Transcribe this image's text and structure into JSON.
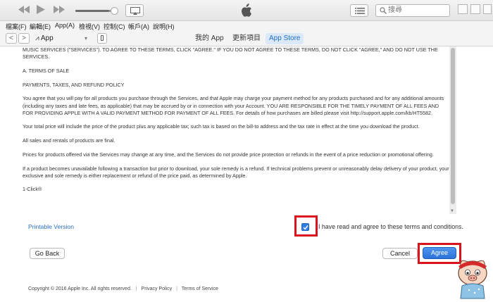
{
  "topbar": {
    "search_placeholder": "搜尋"
  },
  "menubar": {
    "items": [
      "檔案(F)",
      "編輯(E)",
      "App(A)",
      "檢視(V)",
      "控制(C)",
      "帳戶(A)",
      "說明(H)"
    ]
  },
  "navbar": {
    "back": "<",
    "forward": ">",
    "media_kind": "App",
    "tabs": [
      {
        "label": "我的 App",
        "active": false
      },
      {
        "label": "更新項目",
        "active": false
      },
      {
        "label": "App Store",
        "active": true
      }
    ]
  },
  "terms": {
    "paragraphs": [
      "MUSIC SERVICES (\"SERVICES\"). TO AGREE TO THESE TERMS, CLICK \"AGREE.\" IF YOU DO NOT AGREE TO THESE TERMS, DO NOT CLICK \"AGREE,\" AND DO NOT USE THE SERVICES.",
      "A. TERMS OF SALE",
      "PAYMENTS, TAXES, AND REFUND POLICY",
      "You agree that you will pay for all products you purchase through the Services, and that Apple may charge your payment method for any products purchased and for any additional amounts (including any taxes and late fees, as applicable) that may be accrued by or in connection with your Account. YOU ARE RESPONSIBLE FOR THE TIMELY PAYMENT OF ALL FEES AND FOR PROVIDING APPLE WITH A VALID PAYMENT METHOD FOR PAYMENT OF ALL FEES. For details of how purchases are billed please visit http://support.apple.com/kb/HT5582.",
      "Your total price will include the price of the product plus any applicable tax; such tax is based on the bill-to address and the tax rate in effect at the time you download the product.",
      "All sales and rentals of products are final.",
      "Prices for products offered via the Services may change at any time, and the Services do not provide price protection or refunds in the event of a price reduction or promotional offering.",
      "If a product becomes unavailable following a transaction but prior to download, your sole remedy is a refund. If technical problems prevent or unreasonably delay delivery of your product, your exclusive and sole remedy is either replacement or refund of the price paid, as determined by Apple.",
      "1-Click®"
    ]
  },
  "agreement": {
    "printable": "Printable Version",
    "checkbox_checked": true,
    "label": "I have read and agree to these terms and conditions."
  },
  "buttons": {
    "go_back": "Go Back",
    "cancel": "Cancel",
    "agree": "Agree"
  },
  "footer": {
    "copyright": "Copyright © 2016 Apple Inc. All rights reserved.",
    "privacy": "Privacy Policy",
    "terms": "Terms of Service"
  },
  "colors": {
    "accent": "#2f7de1",
    "highlight_border": "#d9141b",
    "link": "#2a6fc0"
  },
  "icons": [
    "rewind-icon",
    "play-icon",
    "fast-forward-icon",
    "airplay-icon",
    "apple-logo-icon",
    "list-icon",
    "search-icon",
    "phone-icon",
    "checkmark-icon"
  ]
}
